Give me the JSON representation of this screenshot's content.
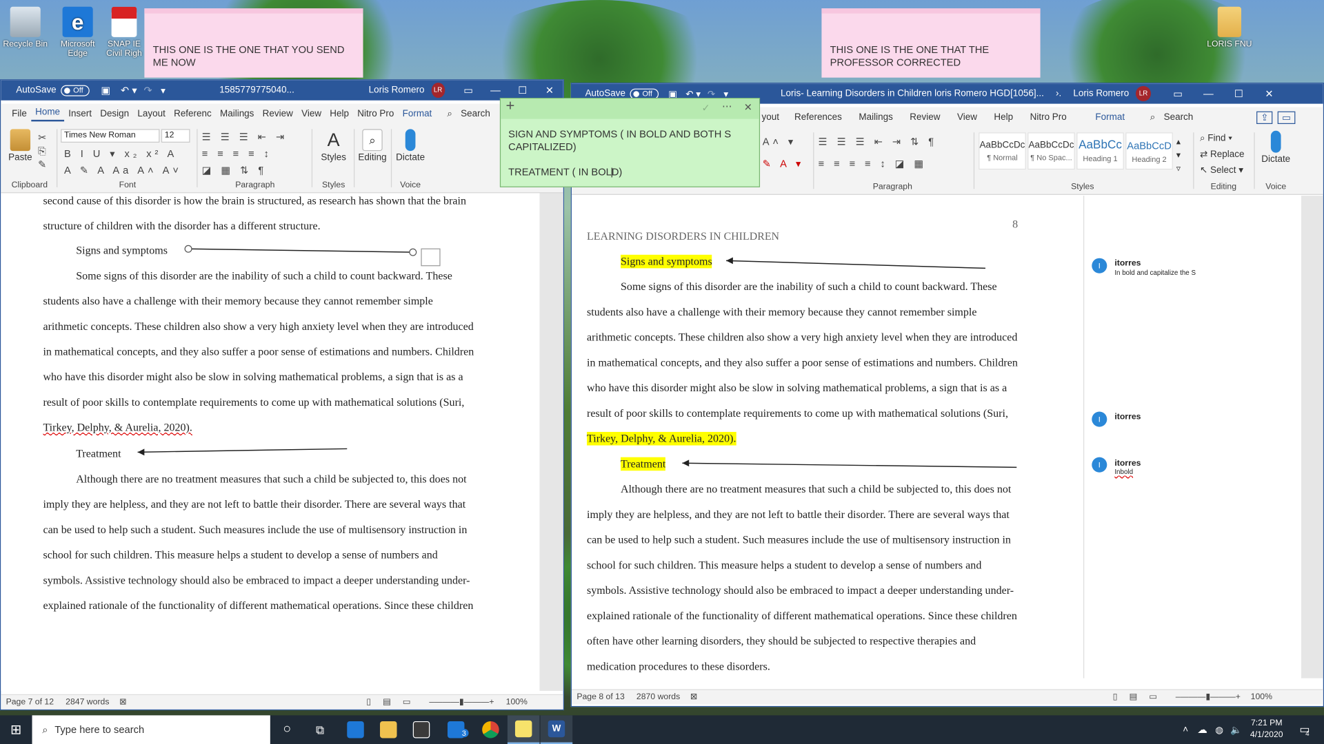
{
  "desktop": {
    "icons": [
      {
        "label": "Recycle Bin"
      },
      {
        "label": "Microsoft Edge"
      },
      {
        "label": "SNAP IE Civil Righ"
      },
      {
        "label": "LORIS FNU"
      }
    ],
    "notes": [
      "THIS ONE IS THE ONE THAT YOU SEND ME NOW",
      "THIS ONE IS THE ONE THAT THE PROFESSOR CORRECTED"
    ]
  },
  "left_window": {
    "autosave": "AutoSave",
    "autosave_state": "Off",
    "title": "1585779775040...",
    "user": "Loris Romero",
    "initials": "LR",
    "tabs": [
      "File",
      "Home",
      "Insert",
      "Design",
      "Layout",
      "Referenc",
      "Mailings",
      "Review",
      "View",
      "Help",
      "Nitro Pro",
      "Format"
    ],
    "search": "Search",
    "font_name": "Times New Roman",
    "font_size": "12",
    "groups": {
      "clipboard": "Clipboard",
      "font": "Font",
      "paragraph": "Paragraph",
      "styles": "Styles",
      "voice": "Voice"
    },
    "buttons": {
      "paste": "Paste",
      "styles": "Styles",
      "editing": "Editing",
      "dictate": "Dictate"
    },
    "doc_lines": [
      "second cause of this disorder is how the brain is structured, as research has shown that the brain",
      "structure of children with the disorder has a different structure.",
      "Signs and symptoms",
      "Some signs of this disorder are the inability of such a child to count backward. These",
      "students also have a challenge with their memory because they cannot remember simple",
      "arithmetic concepts. These children also show a very high anxiety level when they are introduced",
      "in mathematical concepts, and they also suffer a poor sense of estimations and numbers. Children",
      "who have this disorder might also be slow in solving mathematical problems, a sign that is as a",
      "result of poor skills to contemplate requirements to come up with mathematical solutions (Suri,",
      "Tirkey, Delphy, & Aurelia, 2020).",
      "Treatment",
      "Although there are no treatment measures that such a child be subjected to, this does not",
      "imply they are helpless, and they are not left to battle their disorder. There are several ways that",
      "can be used to help such a student. Such measures include the use of multisensory instruction in",
      "school for such children. This measure helps a student to develop a sense of numbers and",
      "symbols. Assistive technology should also be embraced to impact a deeper understanding under-",
      "explained rationale of the functionality of different mathematical operations. Since these children"
    ],
    "status": {
      "page": "Page 7 of 12",
      "words": "2847 words",
      "zoom": "100%"
    }
  },
  "right_window": {
    "autosave": "AutoSave",
    "autosave_state": "Off",
    "title": "Loris- Learning Disorders in Children loris Romero HGD[1056]...",
    "user": "Loris Romero",
    "initials": "LR",
    "tabs": [
      "yout",
      "References",
      "Mailings",
      "Review",
      "View",
      "Help",
      "Nitro Pro",
      "Format"
    ],
    "search": "Search",
    "groups": {
      "paragraph": "Paragraph",
      "styles": "Styles",
      "editing": "Editing",
      "voice": "Voice"
    },
    "styles": [
      {
        "sample": "AaBbCcDc",
        "label": "¶ Normal"
      },
      {
        "sample": "AaBbCcDc",
        "label": "¶ No Spac..."
      },
      {
        "sample": "AaBbCc",
        "label": "Heading 1"
      },
      {
        "sample": "AaBbCcD",
        "label": "Heading 2"
      }
    ],
    "editing": {
      "find": "Find",
      "replace": "Replace",
      "select": "Select"
    },
    "dictate": "Dictate",
    "running_head": "LEARNING DISORDERS IN CHILDREN",
    "page_number": "8",
    "doc_lines": [
      "Signs and symptoms",
      "Some signs of this disorder are the inability of such a child to count backward. These",
      "students also have a challenge with their memory because they cannot remember simple",
      "arithmetic concepts. These children also show a very high anxiety level when they are introduced",
      "in mathematical concepts, and they also suffer a poor sense of estimations and numbers. Children",
      "who have this disorder might also be slow in solving mathematical problems, a sign that is as a",
      "result of poor skills to contemplate requirements to come up with mathematical solutions (Suri,",
      "Tirkey, Delphy, & Aurelia, 2020).",
      "Treatment",
      "Although there are no treatment measures that such a child be subjected to, this does not",
      "imply they are helpless, and they are not left to battle their disorder. There are several ways that",
      "can be used to help such a student. Such measures include the use of multisensory instruction in",
      "school for such children. This measure helps a student to develop a sense of numbers and",
      "symbols. Assistive technology should also be embraced to impact a deeper understanding under-",
      "explained rationale of the functionality of different mathematical operations. Since these children",
      "often have other learning disorders, they should be subjected to respective therapies and",
      "medication procedures to these disorders."
    ],
    "comments": [
      {
        "author": "itorres",
        "text": "In bold and capitalize the S"
      },
      {
        "author": "itorres",
        "text": ""
      },
      {
        "author": "itorres",
        "text": "Inbold"
      }
    ],
    "status": {
      "page": "Page 8 of 13",
      "words": "2870 words",
      "zoom": "100%"
    }
  },
  "sticky_note": {
    "line1": "SIGN AND SYMPTOMS ( IN BOLD AND BOTH S CAPITALIZED)",
    "line2": "TREATMENT ( IN BOLD)"
  },
  "taskbar": {
    "search_placeholder": "Type here to search",
    "mail_badge": "3",
    "time": "7:21 PM",
    "date": "4/1/2020",
    "notification_count": "4"
  },
  "colors": {
    "word_blue": "#2b579a",
    "highlight": "#ffff00",
    "sticky_green": "#ccf5c7",
    "note_pink": "#fbd9ec"
  }
}
